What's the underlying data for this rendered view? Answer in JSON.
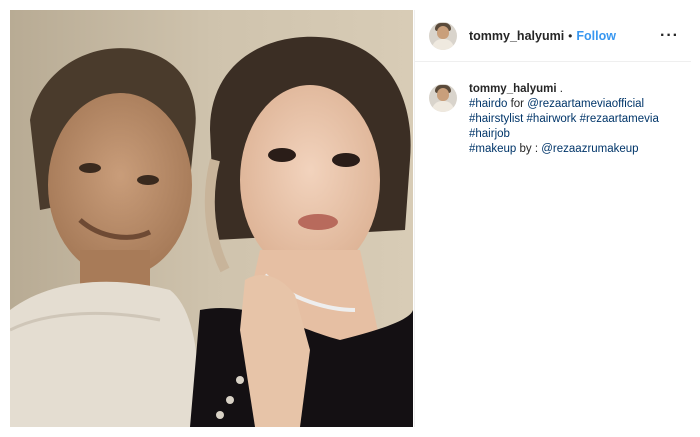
{
  "header": {
    "username": "tommy_halyumi",
    "separator": "•",
    "follow_label": "Follow",
    "more_label": "···",
    "avatar_icon": "profile-avatar"
  },
  "caption": {
    "username": "tommy_halyumi",
    "after_username": " .",
    "line1": {
      "tag": "#hairdo",
      "text": " for ",
      "mention": "@rezaartameviaofficial"
    },
    "line2": {
      "tag1": "#hairstylist",
      "tag2": "#hairwork",
      "tag3": "#rezaartamevia"
    },
    "line3": {
      "tag": "#hairjob"
    },
    "line4": {
      "tag": "#makeup",
      "text": " by : ",
      "mention": "@rezaazrumakeup"
    }
  },
  "colors": {
    "follow": "#3897f0",
    "link": "#003569",
    "divider": "#efefef"
  }
}
